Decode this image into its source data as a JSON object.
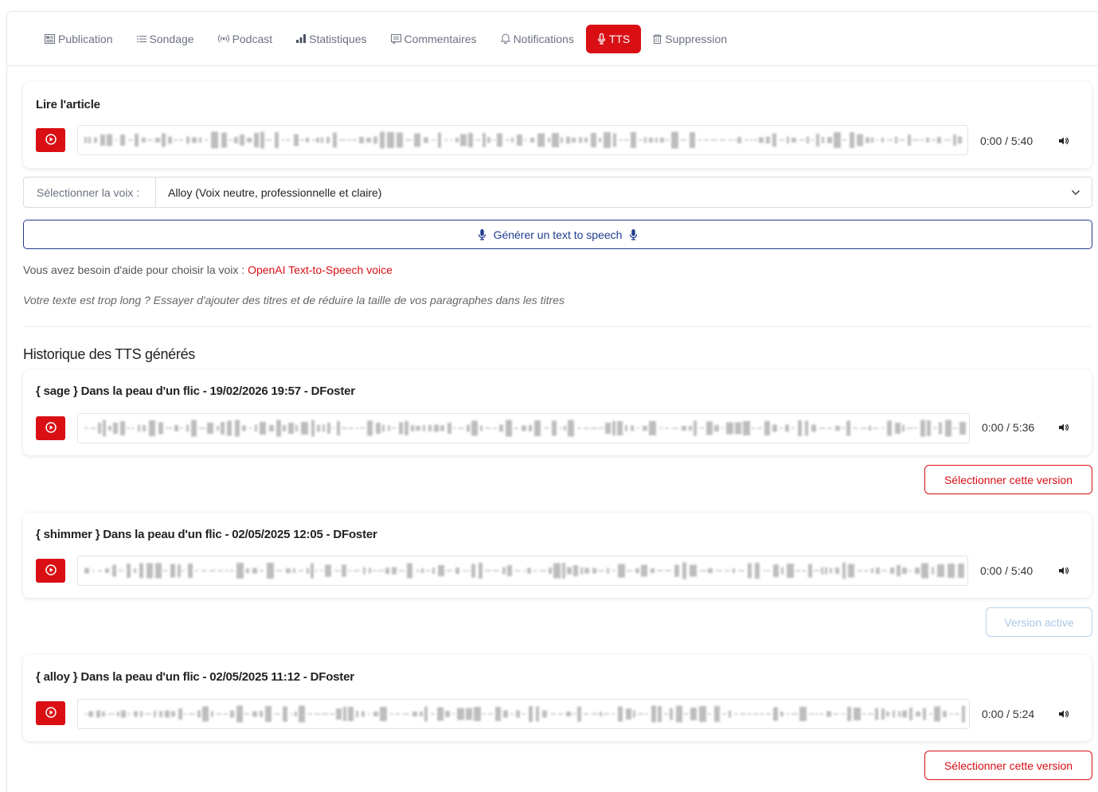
{
  "tabs": [
    {
      "label": "Publication",
      "icon": "newspaper-icon"
    },
    {
      "label": "Sondage",
      "icon": "list-icon"
    },
    {
      "label": "Podcast",
      "icon": "broadcast-icon"
    },
    {
      "label": "Statistiques",
      "icon": "bar-chart-icon"
    },
    {
      "label": "Commentaires",
      "icon": "comment-icon"
    },
    {
      "label": "Notifications",
      "icon": "bell-icon"
    },
    {
      "label": "TTS",
      "icon": "microphone-icon",
      "active": true
    },
    {
      "label": "Suppression",
      "icon": "trash-icon"
    }
  ],
  "reader": {
    "title": "Lire l'article",
    "time": "0:00 / 5:40"
  },
  "voice": {
    "label": "Sélectionner la voix :",
    "selected": "Alloy (Voix neutre, professionnelle et claire)"
  },
  "generate": {
    "label": "Générer un text to speech"
  },
  "help": {
    "text": "Vous avez besoin d'aide pour choisir la voix : ",
    "link": "OpenAI Text-to-Speech voice"
  },
  "hint": "Votre texte est trop long ? Essayer d'ajouter des titres et de réduire la taille de vos paragraphes dans les titres",
  "history": {
    "title": "Historique des TTS générés",
    "items": [
      {
        "title": "{ sage } Dans la peau d'un flic - 19/02/2026 19:57 - DFoster",
        "time": "0:00 / 5:36",
        "button": "Sélectionner cette version",
        "is_active": false
      },
      {
        "title": "{ shimmer } Dans la peau d'un flic - 02/05/2025 12:05 - DFoster",
        "time": "0:00 / 5:40",
        "button": "Version active",
        "is_active": true
      },
      {
        "title": "{ alloy } Dans la peau d'un flic - 02/05/2025 11:12 - DFoster",
        "time": "0:00 / 5:24",
        "button": "Sélectionner cette version",
        "is_active": false
      }
    ]
  },
  "colors": {
    "accent": "#d90f14",
    "generate_border": "#1f3d8f",
    "active_version": "#b6d4f0"
  }
}
